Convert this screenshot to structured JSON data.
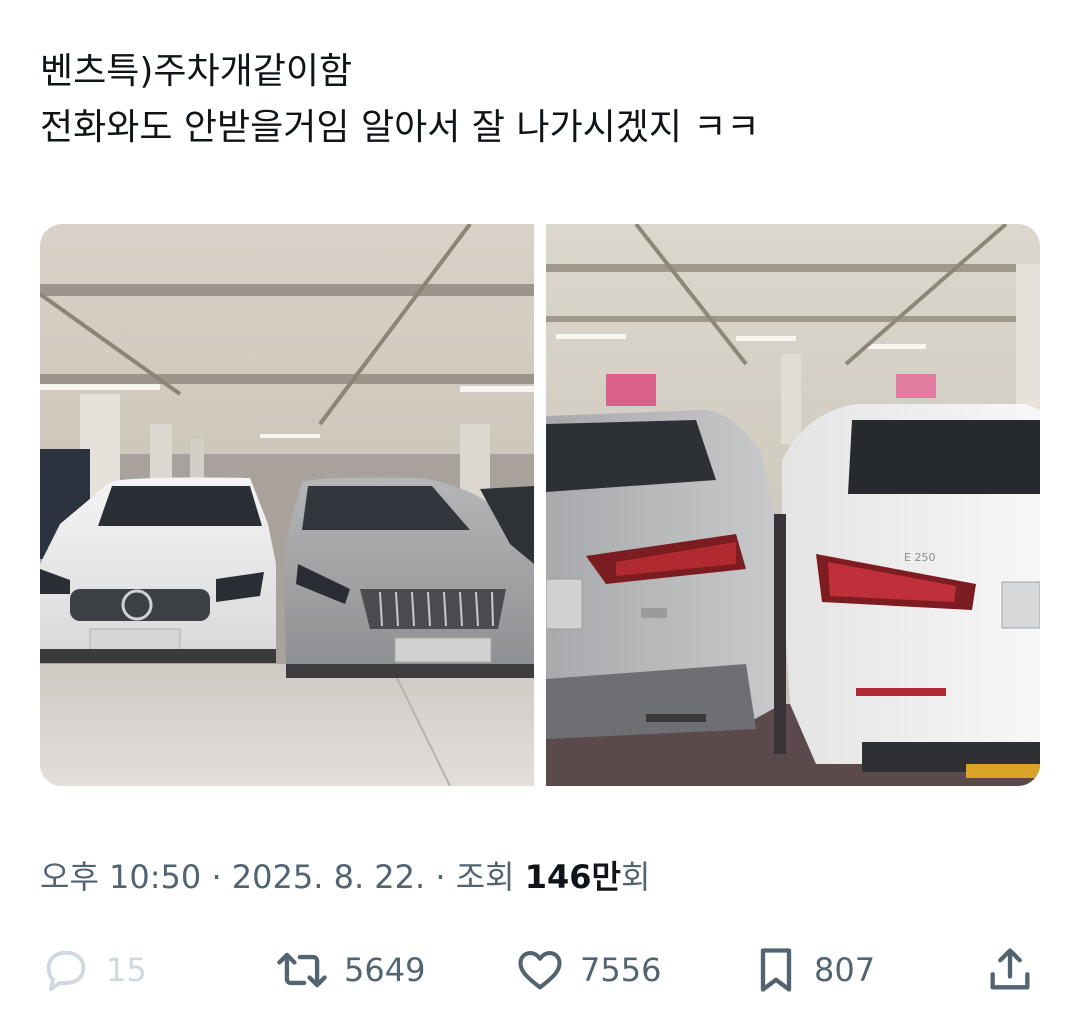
{
  "tweet": {
    "line1": "벤츠특)주차개같이함",
    "line2": "전화와도 안받을거임 알아서 잘 나가시겠지 ㅋㅋ"
  },
  "media": {
    "left_photo": "parked-cars-front",
    "right_photo": "parked-cars-rear",
    "left_badge": "",
    "right_badge_text": "E 250"
  },
  "meta": {
    "time": "오후 10:50",
    "sep1": " · ",
    "date": "2025. 8. 22.",
    "sep2": " · ",
    "views_label": "조회 ",
    "views_count": "146만",
    "views_suffix": "회"
  },
  "actions": {
    "reply_count": "15",
    "retweet_count": "5649",
    "like_count": "7556",
    "bookmark_count": "807"
  },
  "colors": {
    "text_primary": "#0f1419",
    "text_secondary": "#536471",
    "disabled": "#cfd9de"
  }
}
